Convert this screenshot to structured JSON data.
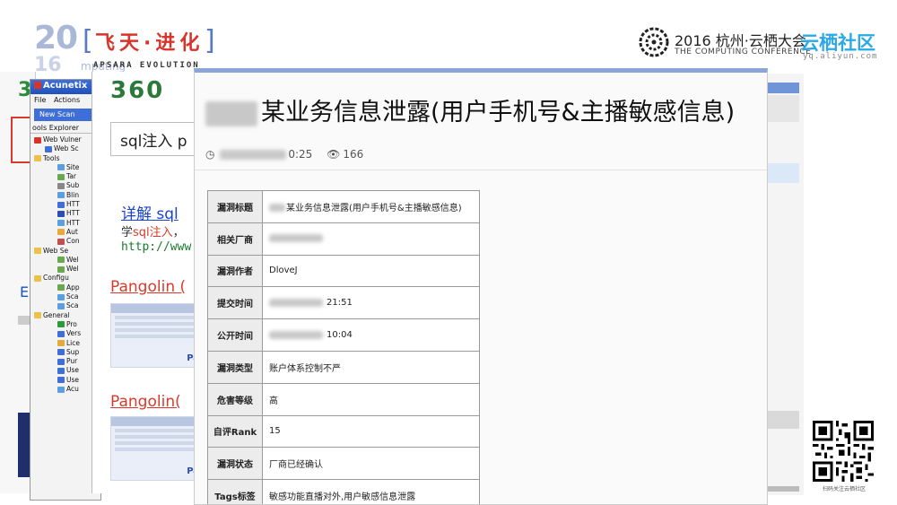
{
  "header": {
    "event_number": "20",
    "event_number_sub": "16",
    "event_slogan_cn": "飞天·进化",
    "event_slogan_en": "APSARA EVOLUTION",
    "event_computing": "mputing",
    "conference_title": "2016 杭州·云栖大会",
    "conference_sub": "THE COMPUTING CONFERENCE",
    "community_brand": "云栖社区",
    "community_url": "yq.aliyun.com"
  },
  "bg_window_left": {
    "brand": "3",
    "link": "E"
  },
  "acunetix": {
    "title": "Acunetix",
    "menu": [
      "File",
      "Actions"
    ],
    "new_scan": "New Scan",
    "explorer": "ools Explorer",
    "tree": [
      {
        "label": "Web Vulner",
        "level": 0,
        "color": "#d9342b"
      },
      {
        "label": "Web Sc",
        "level": 1,
        "color": "#3f6fd6"
      },
      {
        "label": "Tools",
        "level": 0,
        "color": "#e8c24a"
      },
      {
        "label": "Site",
        "level": 2,
        "color": "#5aa0e0"
      },
      {
        "label": "Tar",
        "level": 2,
        "color": "#6aa84f"
      },
      {
        "label": "Sub",
        "level": 2,
        "color": "#888888"
      },
      {
        "label": "Blin",
        "level": 2,
        "color": "#5aa0e0"
      },
      {
        "label": "HTT",
        "level": 2,
        "color": "#3f6fd6"
      },
      {
        "label": "HTT",
        "level": 2,
        "color": "#2a4fb0"
      },
      {
        "label": "HTT",
        "level": 2,
        "color": "#5aa0e0"
      },
      {
        "label": "Aut",
        "level": 2,
        "color": "#e8a83a"
      },
      {
        "label": "Con",
        "level": 2,
        "color": "#c0504d"
      },
      {
        "label": "Web Se",
        "level": 0,
        "color": "#e8c24a"
      },
      {
        "label": "Wel",
        "level": 2,
        "color": "#6aa84f"
      },
      {
        "label": "Wel",
        "level": 2,
        "color": "#6aa84f"
      },
      {
        "label": "Configu",
        "level": 0,
        "color": "#e8c24a"
      },
      {
        "label": "App",
        "level": 2,
        "color": "#6aa84f"
      },
      {
        "label": "Sca",
        "level": 2,
        "color": "#5aa0e0"
      },
      {
        "label": "Sca",
        "level": 2,
        "color": "#5aa0e0"
      },
      {
        "label": "General",
        "level": 0,
        "color": "#e8c24a"
      },
      {
        "label": "Pro",
        "level": 2,
        "color": "#2a9d3a"
      },
      {
        "label": "Vers",
        "level": 2,
        "color": "#3f6fd6"
      },
      {
        "label": "Lice",
        "level": 2,
        "color": "#e8a83a"
      },
      {
        "label": "Sup",
        "level": 2,
        "color": "#3f6fd6"
      },
      {
        "label": "Pur",
        "level": 2,
        "color": "#3f6fd6"
      },
      {
        "label": "Use",
        "level": 2,
        "color": "#3f6fd6"
      },
      {
        "label": "Use",
        "level": 2,
        "color": "#3f6fd6"
      },
      {
        "label": "Acu",
        "level": 2,
        "color": "#5aa0e0"
      }
    ]
  },
  "browser360": {
    "logo": "360",
    "search_value": "sql注入 p",
    "result1_title": "详解 sql",
    "result1_desc_prefix": "学",
    "result1_desc_hl": "sql注入",
    "result1_desc_suffix": "，",
    "result1_url": "http://www",
    "result2_title": "Pangolin (",
    "result3_title": "Pangolin(",
    "thumb_label": "Pa"
  },
  "article": {
    "title": "某业务信息泄露(用户手机号&主播敏感信息)",
    "time_suffix": "0:25",
    "views": "166",
    "rows": [
      {
        "key": "漏洞标题",
        "value": "某业务信息泄露(用户手机号&主播敏感信息)",
        "blur_prefix": true
      },
      {
        "key": "相关厂商",
        "value": "",
        "blur_prefix": true
      },
      {
        "key": "漏洞作者",
        "value": "DloveJ"
      },
      {
        "key": "提交时间",
        "value": "21:51",
        "blur_prefix": true
      },
      {
        "key": "公开时间",
        "value": "10:04",
        "blur_prefix": true
      },
      {
        "key": "漏洞类型",
        "value": "账户体系控制不严"
      },
      {
        "key": "危害等级",
        "value": "高"
      },
      {
        "key": "自评Rank",
        "value": "15"
      },
      {
        "key": "漏洞状态",
        "value": "厂商已经确认"
      },
      {
        "key": "Tags标签",
        "value": "敏感功能直播对外,用户敏感信息泄露",
        "red": true
      }
    ]
  },
  "qr": {
    "caption": "扫码关注云栖社区"
  },
  "colors": {
    "accent_blue": "#2aa8e8",
    "brand_red": "#d9342b",
    "table_border": "#9a9a9a"
  }
}
